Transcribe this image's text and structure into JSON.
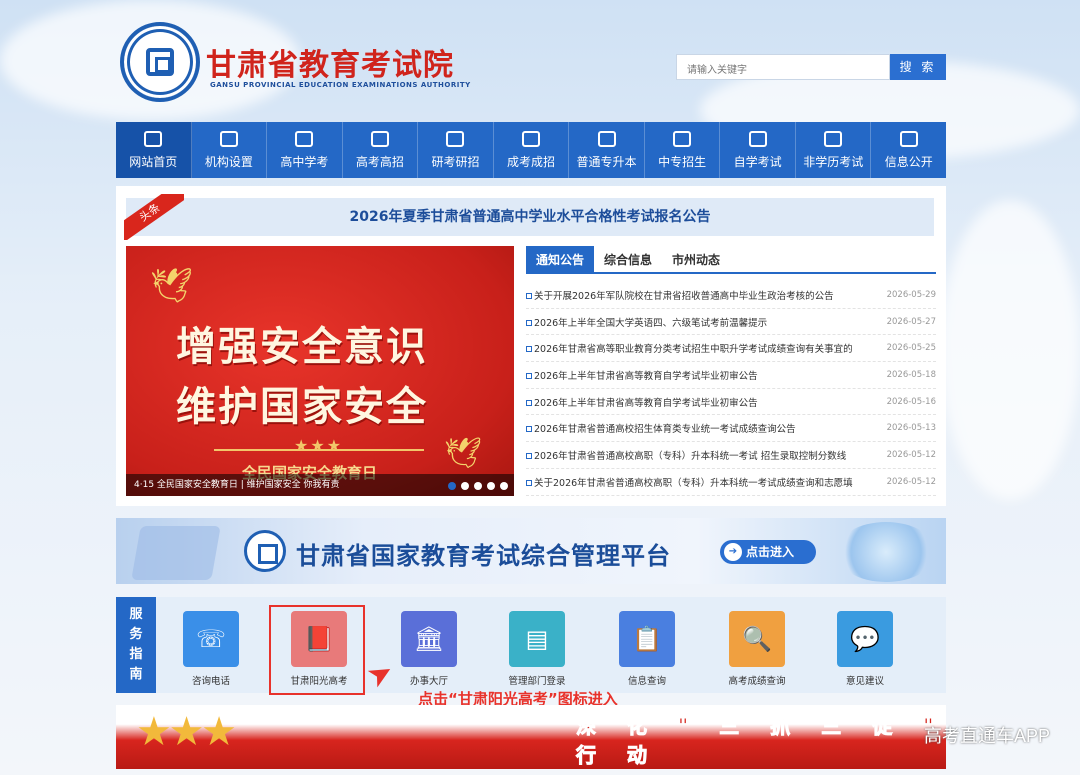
{
  "header": {
    "title": "甘肃省教育考试院",
    "subtitle": "GANSU PROVINCIAL EDUCATION EXAMINATIONS AUTHORITY",
    "search_placeholder": "请输入关键字",
    "search_button": "搜 索"
  },
  "nav": {
    "items": [
      {
        "label": "网站首页",
        "icon": "home-icon"
      },
      {
        "label": "机构设置",
        "icon": "building-icon"
      },
      {
        "label": "高中学考",
        "icon": "student-icon"
      },
      {
        "label": "高考高招",
        "icon": "document-icon"
      },
      {
        "label": "研考研招",
        "icon": "graduation-cap-icon"
      },
      {
        "label": "成考成招",
        "icon": "book-icon"
      },
      {
        "label": "普通专升本",
        "icon": "upgrade-icon"
      },
      {
        "label": "中专招生",
        "icon": "people-icon"
      },
      {
        "label": "自学考试",
        "icon": "list-icon"
      },
      {
        "label": "非学历考试",
        "icon": "certificate-icon"
      },
      {
        "label": "信息公开",
        "icon": "mail-icon"
      }
    ]
  },
  "headline": {
    "tag": "头条",
    "text": "2026年夏季甘肃省普通高中学业水平合格性考试报名公告"
  },
  "banner": {
    "line1": "增强安全意识",
    "line2": "维护国家安全",
    "stars": "★★★",
    "sub": "全民国家安全教育日",
    "caption": "4·15 全民国家安全教育日 | 维护国家安全 你我有责",
    "dots": 5,
    "active_dot": 0
  },
  "news": {
    "tabs": [
      "通知公告",
      "综合信息",
      "市州动态"
    ],
    "items": [
      {
        "title": "关于开展2026年军队院校在甘肃省招收普通高中毕业生政治考核的公告",
        "date": "2026-05-29"
      },
      {
        "title": "2026年上半年全国大学英语四、六级笔试考前温馨提示",
        "date": "2026-05-27"
      },
      {
        "title": "2026年甘肃省高等职业教育分类考试招生中职升学考试成绩查询有关事宜的",
        "date": "2026-05-25"
      },
      {
        "title": "2026年上半年甘肃省高等教育自学考试毕业初审公告",
        "date": "2026-05-18"
      },
      {
        "title": "2026年上半年甘肃省高等教育自学考试毕业初审公告",
        "date": "2026-05-16"
      },
      {
        "title": "2026年甘肃省普通高校招生体育类专业统一考试成绩查询公告",
        "date": "2026-05-13"
      },
      {
        "title": "2026年甘肃省普通高校高职（专科）升本科统一考试 招生录取控制分数线",
        "date": "2026-05-12"
      },
      {
        "title": "关于2026年甘肃省普通高校高职（专科）升本科统一考试成绩查询和志愿填",
        "date": "2026-05-12"
      }
    ]
  },
  "platform": {
    "title": "甘肃省国家教育考试综合管理平台",
    "button": "点击进入"
  },
  "services": {
    "label": [
      "服",
      "务",
      "指",
      "南"
    ],
    "items": [
      {
        "label": "咨询电话",
        "icon": "phone-icon",
        "color": "#3a8fe8"
      },
      {
        "label": "甘肃阳光高考",
        "icon": "book-750-icon",
        "color": "#e87a7a"
      },
      {
        "label": "办事大厅",
        "icon": "hall-icon",
        "color": "#5a6fd8"
      },
      {
        "label": "管理部门登录",
        "icon": "id-card-icon",
        "color": "#3ab1c8"
      },
      {
        "label": "信息查询",
        "icon": "clipboard-icon",
        "color": "#4a7fe0"
      },
      {
        "label": "高考成绩查询",
        "icon": "magnifier-icon",
        "color": "#f0a040"
      },
      {
        "label": "意见建议",
        "icon": "chat-icon",
        "color": "#3a9be0"
      }
    ]
  },
  "annotation": {
    "text": "点击“甘肃阳光高考”图标进入"
  },
  "bottom_banner": {
    "text": "深 化 \" 三 抓 三 促 \" 行 动"
  },
  "watermark": "高考直通车APP",
  "colors": {
    "primary": "#2468c6",
    "accent_red": "#d9261c",
    "title_red": "#d0241c"
  }
}
